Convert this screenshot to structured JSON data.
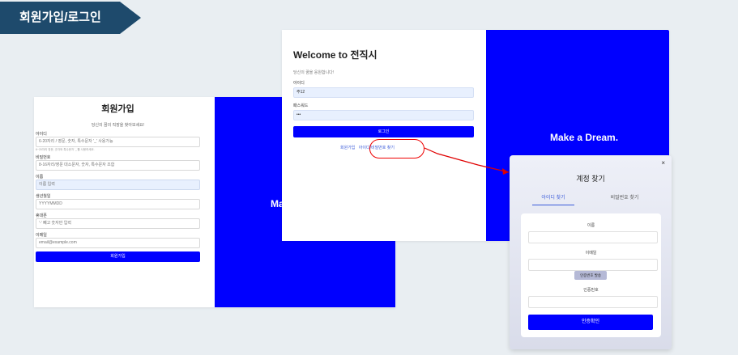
{
  "slide": {
    "tag": "회원가입/로그인"
  },
  "signup": {
    "title": "회원가입",
    "subtitle": "당신의 꿈의 직장을 찾아보세요!",
    "fields": [
      {
        "label": "아이디",
        "placeholder": "6-20자리 / 영문, 숫자, 특수문자 '_' 사용가능",
        "help": "6~20자리 영문, 숫자와 특수문자 '_'를 사용하세요."
      },
      {
        "label": "비밀번호",
        "placeholder": "8-16자리/영문 대소문자, 숫자, 특수문자 조합",
        "help": ""
      },
      {
        "label": "이름",
        "placeholder": "이름 입력",
        "help": ""
      },
      {
        "label": "생년월일",
        "placeholder": "YYYYMMDD",
        "help": ""
      },
      {
        "label": "휴대폰",
        "placeholder": "'-' 빼고 숫자만 입력",
        "help": ""
      },
      {
        "label": "이메일",
        "placeholder": "email@example.com",
        "help": ""
      }
    ],
    "submit": "회원가입",
    "peek_text": "Ma"
  },
  "login": {
    "title": "Welcome to 전직시",
    "subtitle": "당신의 꿈을 응원합니다!",
    "id_label": "아이디",
    "id_value": "주12",
    "pw_label": "패스워드",
    "pw_value": "•••",
    "button": "로그인",
    "link_signup": "회원가입",
    "link_find": "아이디/비밀번호 찾기",
    "slogan": "Make a Dream."
  },
  "find_modal": {
    "close": "×",
    "title": "계정 찾기",
    "tab_id": "아이디 찾기",
    "tab_pw": "비밀번호 찾기",
    "name_label": "이름",
    "email_label": "이메일",
    "send_code": "인증번호 발송",
    "code_label": "인증번호",
    "confirm": "인증확인"
  },
  "colors": {
    "brand_blue": "#0000ff",
    "tag_bg": "#1e4a6c",
    "annotation": "#e00000"
  }
}
